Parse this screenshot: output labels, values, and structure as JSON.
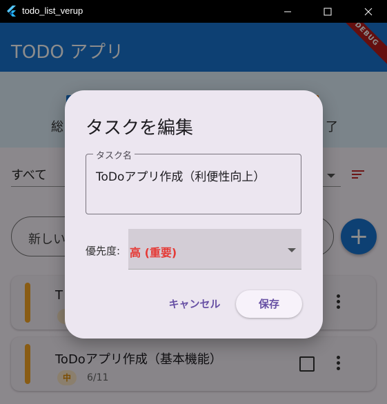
{
  "window": {
    "title": "todo_list_verup"
  },
  "appbar": {
    "title": "TODO アプリ",
    "debug_banner": "DEBUG"
  },
  "stats": {
    "left_label": "総",
    "right_label": "了"
  },
  "filter": {
    "selected": "すべて"
  },
  "new_task": {
    "placeholder": "新しい"
  },
  "tasks": [
    {
      "title": "T",
      "priority": "",
      "date": ""
    },
    {
      "title": "ToDoアプリ作成（基本機能）",
      "priority": "中",
      "date": "6/11"
    }
  ],
  "dialog": {
    "title": "タスクを編集",
    "task_name_label": "タスク名",
    "task_name_value": "ToDoアプリ作成（利便性向上）",
    "priority_label": "優先度:",
    "priority_value": "高 (重要)",
    "cancel_label": "キャンセル",
    "save_label": "保存"
  },
  "colors": {
    "primary": "#1976d2",
    "priority_high": "#e53935",
    "priority_mid": "#f9a825",
    "dialog_accent": "#6750a4"
  }
}
